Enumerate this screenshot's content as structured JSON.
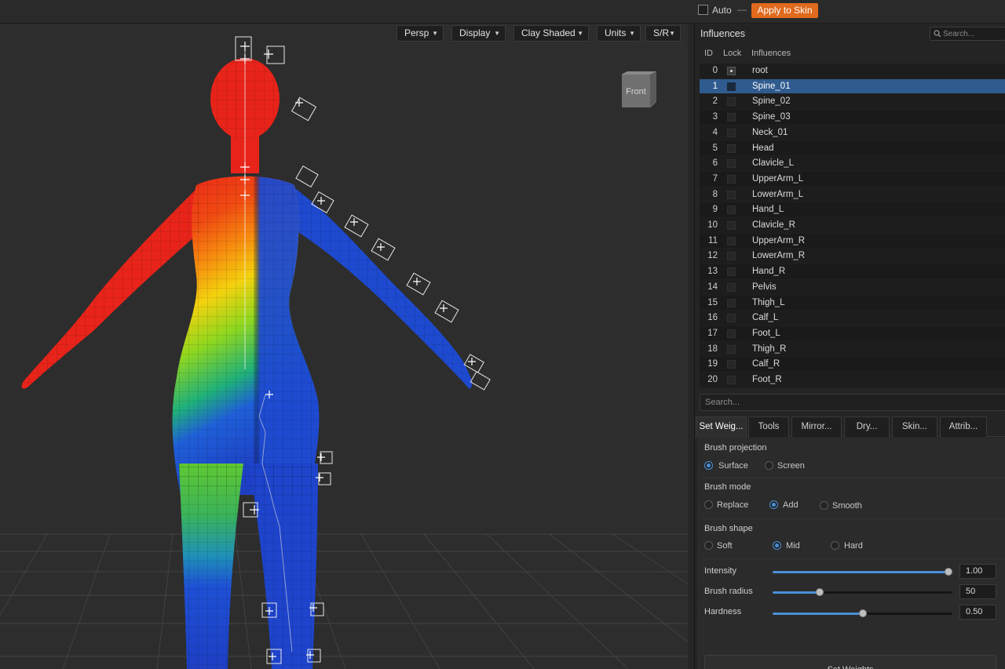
{
  "topbar": {
    "auto_label": "Auto",
    "dash": "—",
    "apply_label": "Apply to Skin",
    "apply_color": "#e06a1e"
  },
  "viewport": {
    "menus": [
      "Persp",
      "Display",
      "Clay Shaded",
      "Units",
      "S/R"
    ],
    "cube_label": "Front",
    "shading": "skin weight heatmap (red = full weight, blue = zero)"
  },
  "influences": {
    "title": "Influences",
    "search_placeholder": "Search...",
    "headers": {
      "id": "ID",
      "lock": "Lock",
      "name": "Influences"
    },
    "selected_id": 1,
    "rows": [
      {
        "id": "0",
        "name": "root"
      },
      {
        "id": "1",
        "name": "Spine_01"
      },
      {
        "id": "2",
        "name": "Spine_02"
      },
      {
        "id": "3",
        "name": "Spine_03"
      },
      {
        "id": "4",
        "name": "Neck_01"
      },
      {
        "id": "5",
        "name": "Head"
      },
      {
        "id": "6",
        "name": "Clavicle_L"
      },
      {
        "id": "7",
        "name": "UpperArm_L"
      },
      {
        "id": "8",
        "name": "LowerArm_L"
      },
      {
        "id": "9",
        "name": "Hand_L"
      },
      {
        "id": "10",
        "name": "Clavicle_R"
      },
      {
        "id": "11",
        "name": "UpperArm_R"
      },
      {
        "id": "12",
        "name": "LowerArm_R"
      },
      {
        "id": "13",
        "name": "Hand_R"
      },
      {
        "id": "14",
        "name": "Pelvis"
      },
      {
        "id": "15",
        "name": "Thigh_L"
      },
      {
        "id": "16",
        "name": "Calf_L"
      },
      {
        "id": "17",
        "name": "Foot_L"
      },
      {
        "id": "18",
        "name": "Thigh_R"
      },
      {
        "id": "19",
        "name": "Calf_R"
      },
      {
        "id": "20",
        "name": "Foot_R"
      }
    ],
    "list_search_placeholder": "Search..."
  },
  "tabs": [
    "Set Weig...",
    "Tools",
    "Mirror...",
    "Dry...",
    "Skin...",
    "Attrib..."
  ],
  "settings": {
    "brush_projection": {
      "label": "Brush projection",
      "options": [
        "Surface",
        "Screen"
      ],
      "selected": "Surface"
    },
    "brush_mode": {
      "label": "Brush mode",
      "options": [
        "Replace",
        "Add",
        "Smooth"
      ],
      "selected": "Add"
    },
    "brush_shape": {
      "label": "Brush shape",
      "options": [
        "Soft",
        "Mid",
        "Hard"
      ],
      "selected": "Mid"
    },
    "intensity": {
      "label": "Intensity",
      "value": "1.00",
      "fraction": 1.0
    },
    "brush_radius": {
      "label": "Brush radius",
      "value": "50",
      "fraction": 0.25
    },
    "hardness": {
      "label": "Hardness",
      "value": "0.50",
      "fraction": 0.5
    },
    "set_weights_label": "Set Weights",
    "accent_color": "#4a90d9"
  }
}
